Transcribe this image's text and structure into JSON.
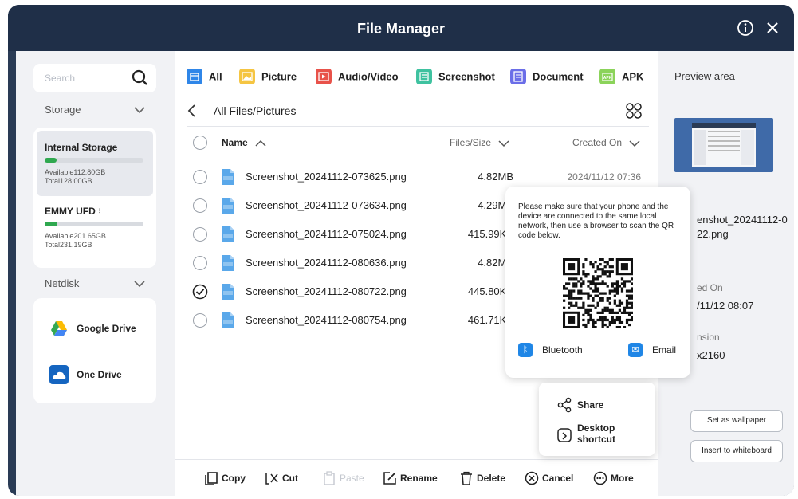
{
  "window": {
    "title": "File Manager",
    "info_icon": "info-icon",
    "close_icon": "close-icon"
  },
  "sidebar": {
    "search_placeholder": "Search",
    "storage_label": "Storage",
    "storages": [
      {
        "name": "Internal Storage",
        "available": "Available112.80GB",
        "total": "Total128.00GB",
        "used_fraction": 0.12,
        "selected": true
      },
      {
        "name": "EMMY UFD",
        "available": "Available201.65GB",
        "total": "Total231.19GB",
        "used_fraction": 0.13,
        "selected": false
      }
    ],
    "netdisk_label": "Netdisk",
    "netdisks": [
      {
        "name": "Google Drive",
        "icon": "google-drive-icon"
      },
      {
        "name": "One Drive",
        "icon": "onedrive-icon"
      }
    ]
  },
  "tabs": [
    {
      "label": "All",
      "icon": "all-icon",
      "color": "#2f86e8",
      "active": true
    },
    {
      "label": "Picture",
      "icon": "picture-icon",
      "color": "#f5c542"
    },
    {
      "label": "Audio/Video",
      "icon": "audio-video-icon",
      "color": "#e8524a"
    },
    {
      "label": "Screenshot",
      "icon": "screenshot-icon",
      "color": "#3fc2a0"
    },
    {
      "label": "Document",
      "icon": "document-icon",
      "color": "#6b6ee8"
    },
    {
      "label": "APK",
      "icon": "apk-icon",
      "color": "#8bd35a"
    }
  ],
  "breadcrumb": "All Files/Pictures",
  "columns": {
    "name": "Name",
    "size": "Files/Size",
    "created": "Created On"
  },
  "files": [
    {
      "name": "Screenshot_20241112-073625.png",
      "size": "4.82MB",
      "created": "2024/11/12 07:36",
      "checked": false
    },
    {
      "name": "Screenshot_20241112-073634.png",
      "size": "4.29MB",
      "created": "",
      "checked": false
    },
    {
      "name": "Screenshot_20241112-075024.png",
      "size": "415.99KB",
      "created": "",
      "checked": false
    },
    {
      "name": "Screenshot_20241112-080636.png",
      "size": "4.82MB",
      "created": "",
      "checked": false
    },
    {
      "name": "Screenshot_20241112-080722.png",
      "size": "445.80KB",
      "created": "",
      "checked": true
    },
    {
      "name": "Screenshot_20241112-080754.png",
      "size": "461.71KB",
      "created": "",
      "checked": false
    }
  ],
  "actions": [
    {
      "label": "Copy",
      "icon": "copy-icon",
      "enabled": true
    },
    {
      "label": "Cut",
      "icon": "cut-icon",
      "enabled": true
    },
    {
      "label": "Paste",
      "icon": "paste-icon",
      "enabled": false
    },
    {
      "label": "Rename",
      "icon": "rename-icon",
      "enabled": true
    },
    {
      "label": "Delete",
      "icon": "delete-icon",
      "enabled": true
    },
    {
      "label": "Cancel",
      "icon": "cancel-icon",
      "enabled": true
    },
    {
      "label": "More",
      "icon": "more-icon",
      "enabled": true
    }
  ],
  "preview": {
    "title": "Preview area",
    "filename_line1": "enshot_20241112-0",
    "filename_line2": "22.png",
    "created_label": "ed On",
    "created_value": "/11/12 08:07",
    "dimension_label": "nsion",
    "dimension_value": "x2160",
    "wallpaper_btn": "Set as wallpaper",
    "whiteboard_btn": "Insert to whiteboard"
  },
  "share_popup": {
    "message": "Please make sure that your phone and the device are connected to the same local network, then use a browser to scan the QR code below.",
    "bluetooth": "Bluetooth",
    "email": "Email"
  },
  "context_menu": {
    "share": "Share",
    "desktop_line1": "Desktop",
    "desktop_line2": "shortcut"
  }
}
